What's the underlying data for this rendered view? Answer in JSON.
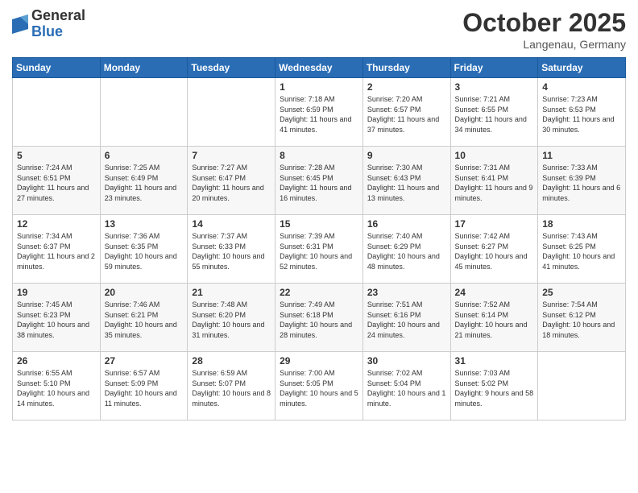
{
  "logo": {
    "general": "General",
    "blue": "Blue"
  },
  "header": {
    "month": "October 2025",
    "location": "Langenau, Germany"
  },
  "weekdays": [
    "Sunday",
    "Monday",
    "Tuesday",
    "Wednesday",
    "Thursday",
    "Friday",
    "Saturday"
  ],
  "weeks": [
    [
      {
        "day": "",
        "info": ""
      },
      {
        "day": "",
        "info": ""
      },
      {
        "day": "",
        "info": ""
      },
      {
        "day": "1",
        "info": "Sunrise: 7:18 AM\nSunset: 6:59 PM\nDaylight: 11 hours and 41 minutes."
      },
      {
        "day": "2",
        "info": "Sunrise: 7:20 AM\nSunset: 6:57 PM\nDaylight: 11 hours and 37 minutes."
      },
      {
        "day": "3",
        "info": "Sunrise: 7:21 AM\nSunset: 6:55 PM\nDaylight: 11 hours and 34 minutes."
      },
      {
        "day": "4",
        "info": "Sunrise: 7:23 AM\nSunset: 6:53 PM\nDaylight: 11 hours and 30 minutes."
      }
    ],
    [
      {
        "day": "5",
        "info": "Sunrise: 7:24 AM\nSunset: 6:51 PM\nDaylight: 11 hours and 27 minutes."
      },
      {
        "day": "6",
        "info": "Sunrise: 7:25 AM\nSunset: 6:49 PM\nDaylight: 11 hours and 23 minutes."
      },
      {
        "day": "7",
        "info": "Sunrise: 7:27 AM\nSunset: 6:47 PM\nDaylight: 11 hours and 20 minutes."
      },
      {
        "day": "8",
        "info": "Sunrise: 7:28 AM\nSunset: 6:45 PM\nDaylight: 11 hours and 16 minutes."
      },
      {
        "day": "9",
        "info": "Sunrise: 7:30 AM\nSunset: 6:43 PM\nDaylight: 11 hours and 13 minutes."
      },
      {
        "day": "10",
        "info": "Sunrise: 7:31 AM\nSunset: 6:41 PM\nDaylight: 11 hours and 9 minutes."
      },
      {
        "day": "11",
        "info": "Sunrise: 7:33 AM\nSunset: 6:39 PM\nDaylight: 11 hours and 6 minutes."
      }
    ],
    [
      {
        "day": "12",
        "info": "Sunrise: 7:34 AM\nSunset: 6:37 PM\nDaylight: 11 hours and 2 minutes."
      },
      {
        "day": "13",
        "info": "Sunrise: 7:36 AM\nSunset: 6:35 PM\nDaylight: 10 hours and 59 minutes."
      },
      {
        "day": "14",
        "info": "Sunrise: 7:37 AM\nSunset: 6:33 PM\nDaylight: 10 hours and 55 minutes."
      },
      {
        "day": "15",
        "info": "Sunrise: 7:39 AM\nSunset: 6:31 PM\nDaylight: 10 hours and 52 minutes."
      },
      {
        "day": "16",
        "info": "Sunrise: 7:40 AM\nSunset: 6:29 PM\nDaylight: 10 hours and 48 minutes."
      },
      {
        "day": "17",
        "info": "Sunrise: 7:42 AM\nSunset: 6:27 PM\nDaylight: 10 hours and 45 minutes."
      },
      {
        "day": "18",
        "info": "Sunrise: 7:43 AM\nSunset: 6:25 PM\nDaylight: 10 hours and 41 minutes."
      }
    ],
    [
      {
        "day": "19",
        "info": "Sunrise: 7:45 AM\nSunset: 6:23 PM\nDaylight: 10 hours and 38 minutes."
      },
      {
        "day": "20",
        "info": "Sunrise: 7:46 AM\nSunset: 6:21 PM\nDaylight: 10 hours and 35 minutes."
      },
      {
        "day": "21",
        "info": "Sunrise: 7:48 AM\nSunset: 6:20 PM\nDaylight: 10 hours and 31 minutes."
      },
      {
        "day": "22",
        "info": "Sunrise: 7:49 AM\nSunset: 6:18 PM\nDaylight: 10 hours and 28 minutes."
      },
      {
        "day": "23",
        "info": "Sunrise: 7:51 AM\nSunset: 6:16 PM\nDaylight: 10 hours and 24 minutes."
      },
      {
        "day": "24",
        "info": "Sunrise: 7:52 AM\nSunset: 6:14 PM\nDaylight: 10 hours and 21 minutes."
      },
      {
        "day": "25",
        "info": "Sunrise: 7:54 AM\nSunset: 6:12 PM\nDaylight: 10 hours and 18 minutes."
      }
    ],
    [
      {
        "day": "26",
        "info": "Sunrise: 6:55 AM\nSunset: 5:10 PM\nDaylight: 10 hours and 14 minutes."
      },
      {
        "day": "27",
        "info": "Sunrise: 6:57 AM\nSunset: 5:09 PM\nDaylight: 10 hours and 11 minutes."
      },
      {
        "day": "28",
        "info": "Sunrise: 6:59 AM\nSunset: 5:07 PM\nDaylight: 10 hours and 8 minutes."
      },
      {
        "day": "29",
        "info": "Sunrise: 7:00 AM\nSunset: 5:05 PM\nDaylight: 10 hours and 5 minutes."
      },
      {
        "day": "30",
        "info": "Sunrise: 7:02 AM\nSunset: 5:04 PM\nDaylight: 10 hours and 1 minute."
      },
      {
        "day": "31",
        "info": "Sunrise: 7:03 AM\nSunset: 5:02 PM\nDaylight: 9 hours and 58 minutes."
      },
      {
        "day": "",
        "info": ""
      }
    ]
  ]
}
